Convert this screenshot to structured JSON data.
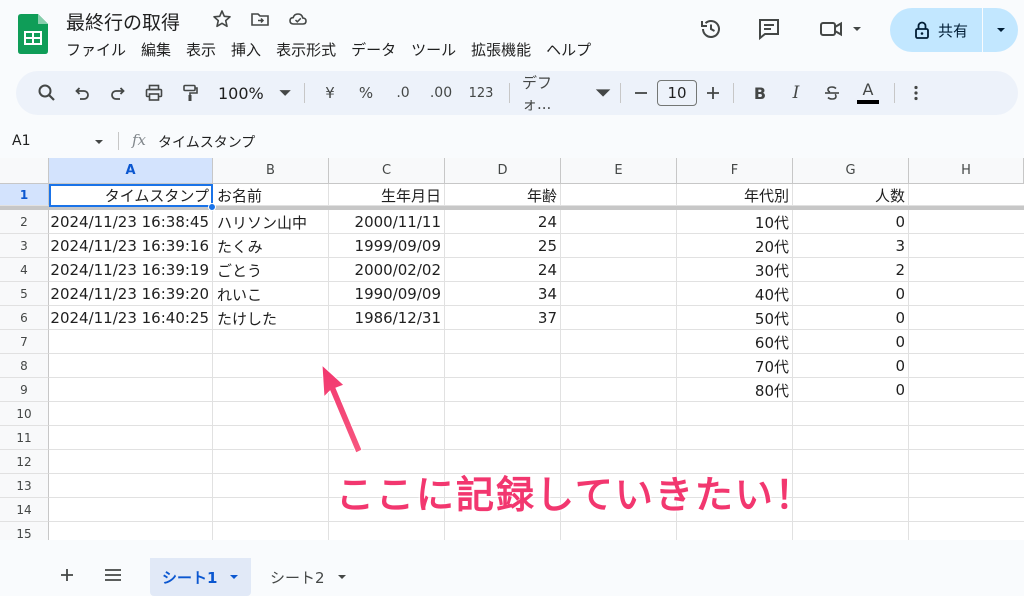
{
  "app": {
    "doc_title": "最終行の取得",
    "menu": [
      "ファイル",
      "編集",
      "表示",
      "挿入",
      "表示形式",
      "データ",
      "ツール",
      "拡張機能",
      "ヘルプ"
    ],
    "share_label": "共有"
  },
  "toolbar": {
    "zoom": "100%",
    "currency": "¥",
    "percent": "%",
    "dec_decrease": ".0",
    "dec_increase": ".00",
    "number_format": "123",
    "font": "デフォ...",
    "font_size": "10",
    "bold": "B",
    "italic": "I",
    "text_color": "A"
  },
  "formula_bar": {
    "name_box": "A1",
    "formula": "タイムスタンプ"
  },
  "grid": {
    "columns": [
      "A",
      "B",
      "C",
      "D",
      "E",
      "F",
      "G",
      "H"
    ],
    "row_numbers": [
      "1",
      "2",
      "3",
      "4",
      "5",
      "6",
      "7",
      "8",
      "9",
      "10",
      "11",
      "12",
      "13",
      "14",
      "15"
    ],
    "header_row": [
      "タイムスタンプ",
      "お名前",
      "生年月日",
      "年齢",
      "",
      "年代別",
      "人数",
      ""
    ],
    "rows": [
      [
        "2024/11/23 16:38:45",
        "ハリソン山中",
        "2000/11/11",
        "24",
        "",
        "10代",
        "0",
        ""
      ],
      [
        "2024/11/23 16:39:16",
        "たくみ",
        "1999/09/09",
        "25",
        "",
        "20代",
        "3",
        ""
      ],
      [
        "2024/11/23 16:39:19",
        "ごとう",
        "2000/02/02",
        "24",
        "",
        "30代",
        "2",
        ""
      ],
      [
        "2024/11/23 16:39:20",
        "れいこ",
        "1990/09/09",
        "34",
        "",
        "40代",
        "0",
        ""
      ],
      [
        "2024/11/23 16:40:25",
        "たけした",
        "1986/12/31",
        "37",
        "",
        "50代",
        "0",
        ""
      ],
      [
        "",
        "",
        "",
        "",
        "",
        "60代",
        "0",
        ""
      ],
      [
        "",
        "",
        "",
        "",
        "",
        "70代",
        "0",
        ""
      ],
      [
        "",
        "",
        "",
        "",
        "",
        "80代",
        "0",
        ""
      ]
    ]
  },
  "annotation": {
    "text": "ここに記録していきたい！",
    "color": "#f2376f"
  },
  "sheets": {
    "tabs": [
      "シート1",
      "シート2"
    ],
    "active": "シート1"
  },
  "colors": {
    "accent": "#1a73e8",
    "share_bg": "#c2e7ff",
    "sheets_green": "#0f9d58"
  }
}
